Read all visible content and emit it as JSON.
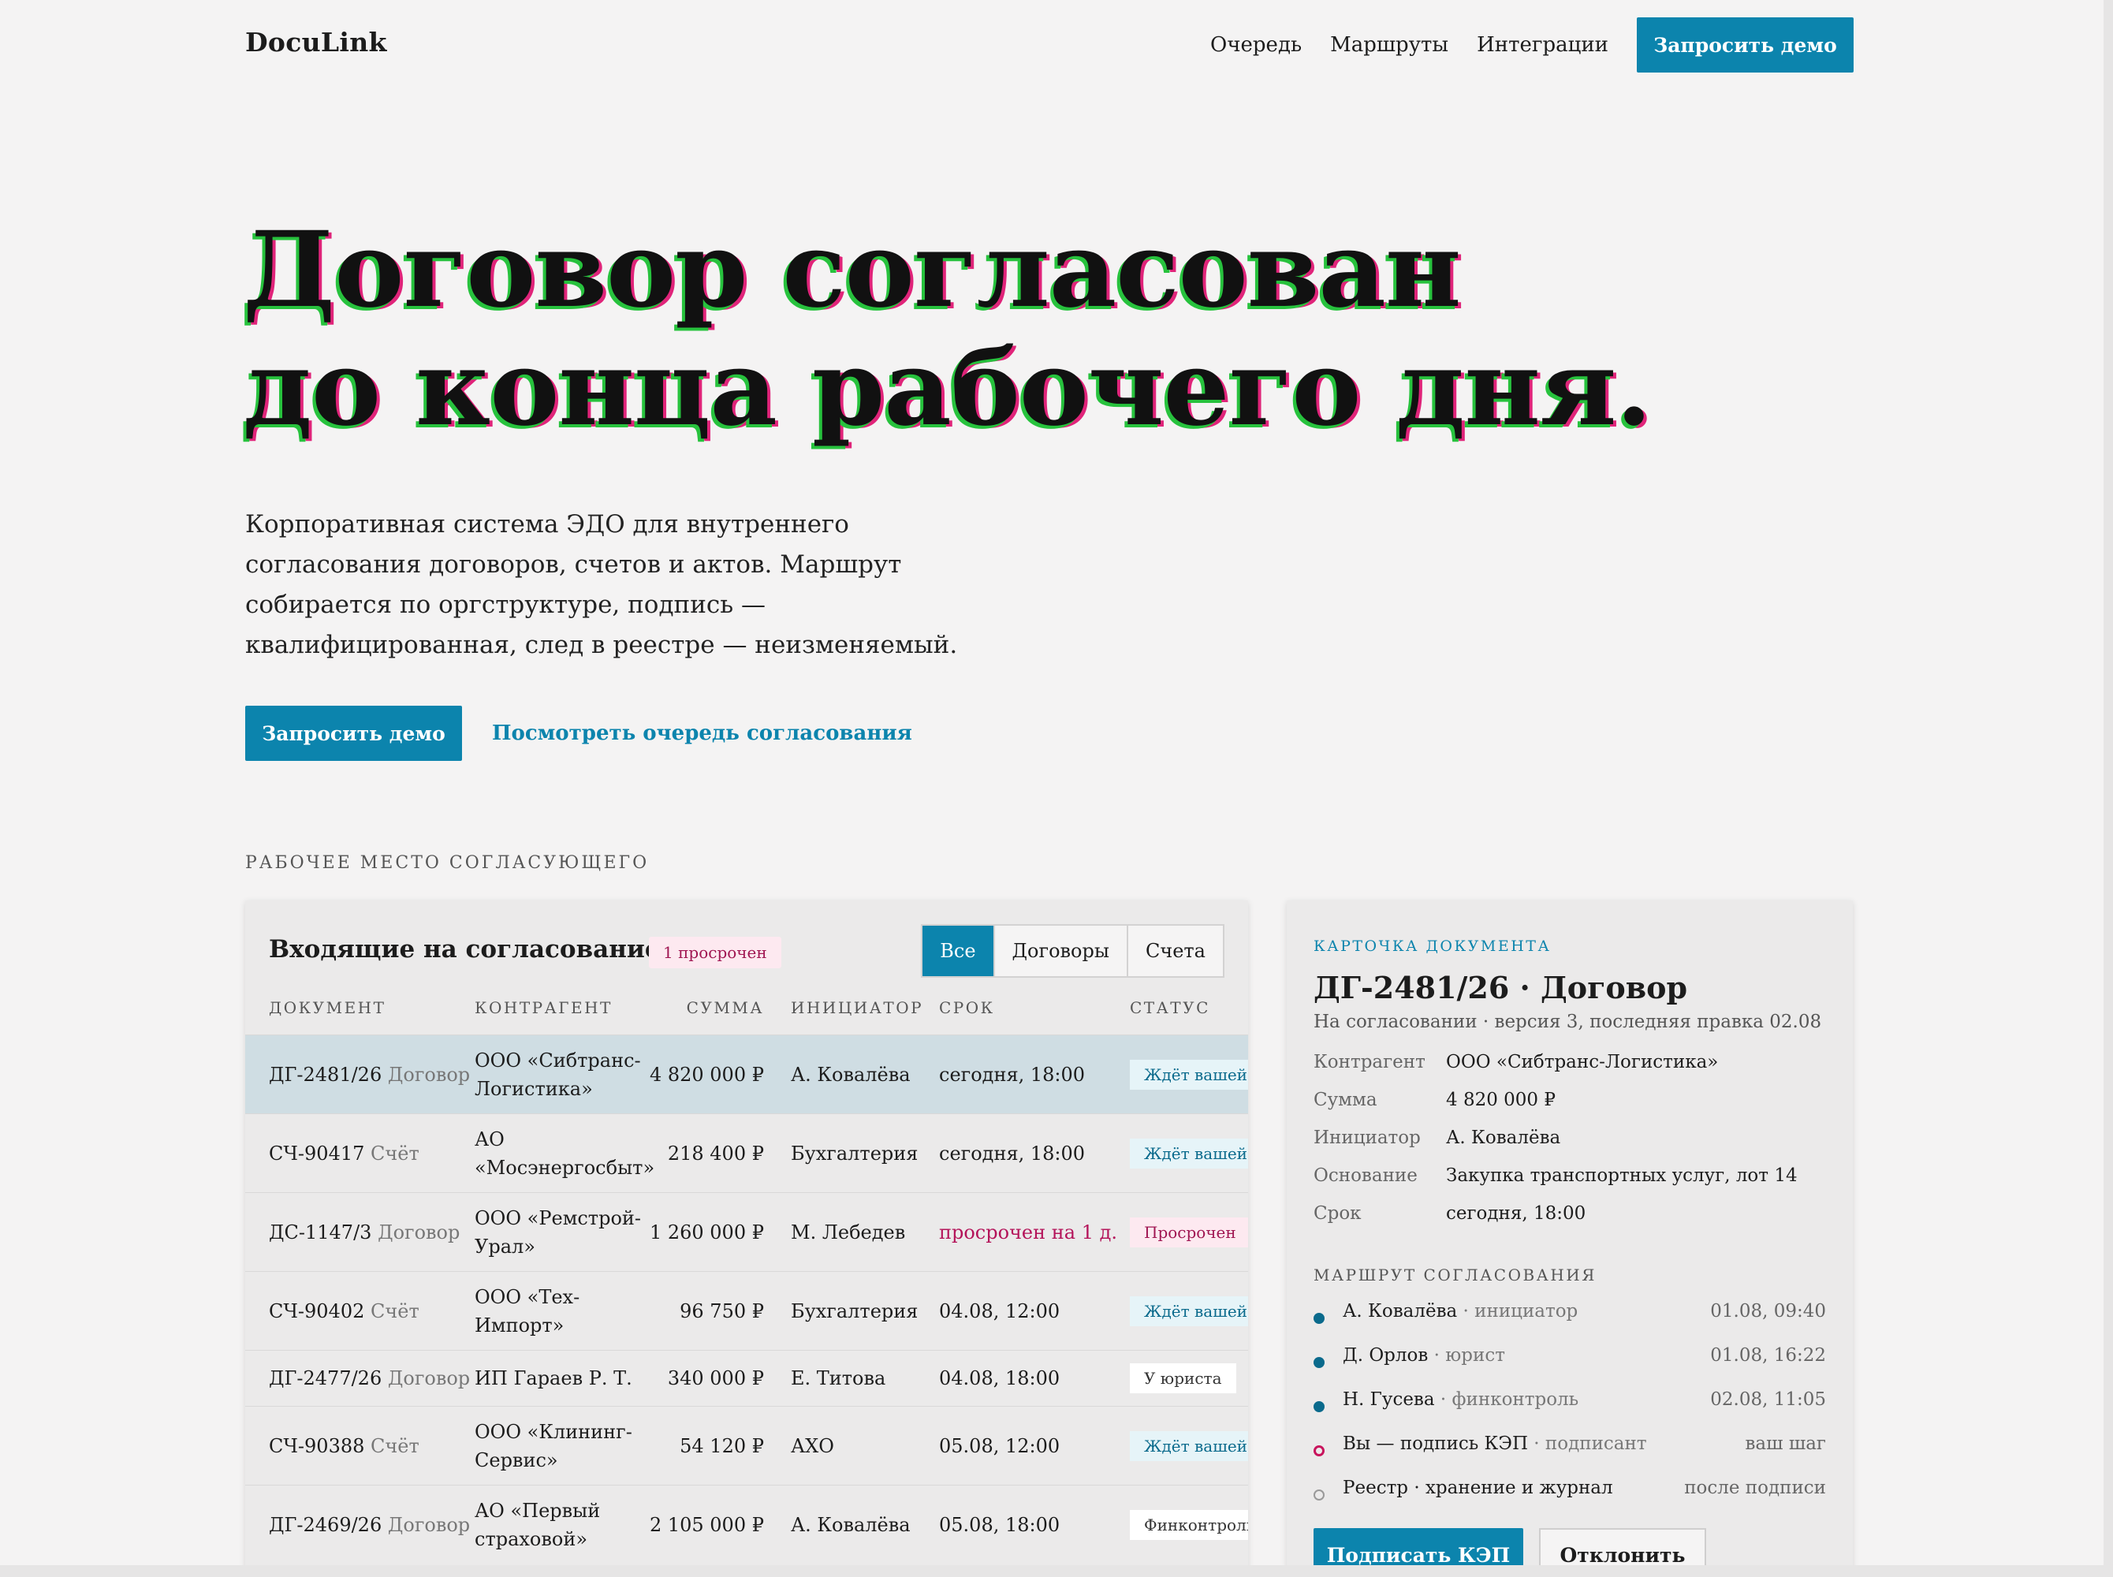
{
  "header": {
    "logo": "DocuLink",
    "nav": [
      "Очередь",
      "Маршруты",
      "Интеграции"
    ],
    "cta": "Запросить демо"
  },
  "hero": {
    "title_line1": "Договор согласован",
    "title_line2": "до конца рабочего дня.",
    "subtitle": "Корпоративная система ЭДО для внутреннего согласования договоров, счетов и актов. Маршрут собирается по оргструктуре, подпись — квалифицированная, след в реестре — неизменяемый.",
    "cta_primary": "Запросить демо",
    "cta_secondary": "Посмотреть очередь согласования"
  },
  "section_label": "РАБОЧЕЕ МЕСТО СОГЛАСУЮЩЕГО",
  "queue": {
    "title": "Входящие на согласование",
    "overdue_badge": "1 просрочен",
    "tabs": [
      "Все",
      "Договоры",
      "Счета"
    ],
    "active_tab": "Все",
    "columns": [
      "ДОКУМЕНТ",
      "КОНТРАГЕНТ",
      "СУММА",
      "ИНИЦИАТОР",
      "СРОК",
      "СТАТУС"
    ],
    "rows": [
      {
        "id": "ДГ-2481/26",
        "type": "Договор",
        "counterparty": "ООО «Сибтранс-Логистика»",
        "sum": "4 820 000 ₽",
        "initiator": "А. Ковалёва",
        "due": "сегодня, 18:00",
        "status": "Ждёт вашей",
        "status_kind": "wait",
        "selected": true
      },
      {
        "id": "СЧ-90417",
        "type": "Счёт",
        "counterparty": "АО «Мосэнергосбыт»",
        "sum": "218 400 ₽",
        "initiator": "Бухгалтерия",
        "due": "сегодня, 18:00",
        "status": "Ждёт вашей",
        "status_kind": "wait"
      },
      {
        "id": "ДС-1147/3",
        "type": "Договор",
        "counterparty": "ООО «Ремстрой-Урал»",
        "sum": "1 260 000 ₽",
        "initiator": "М. Лебедев",
        "due": "просрочен на 1 д.",
        "status": "Просрочен",
        "status_kind": "late"
      },
      {
        "id": "СЧ-90402",
        "type": "Счёт",
        "counterparty": "ООО «Тех-Импорт»",
        "sum": "96 750 ₽",
        "initiator": "Бухгалтерия",
        "due": "04.08, 12:00",
        "status": "Ждёт вашей",
        "status_kind": "wait"
      },
      {
        "id": "ДГ-2477/26",
        "type": "Договор",
        "counterparty": "ИП Гараев Р. Т.",
        "sum": "340 000 ₽",
        "initiator": "Е. Титова",
        "due": "04.08, 18:00",
        "status": "У юриста",
        "status_kind": "neutral"
      },
      {
        "id": "СЧ-90388",
        "type": "Счёт",
        "counterparty": "ООО «Клининг-Сервис»",
        "sum": "54 120 ₽",
        "initiator": "АХО",
        "due": "05.08, 12:00",
        "status": "Ждёт вашей",
        "status_kind": "wait"
      },
      {
        "id": "ДГ-2469/26",
        "type": "Договор",
        "counterparty": "АО «Первый страховой»",
        "sum": "2 105 000 ₽",
        "initiator": "А. Ковалёва",
        "due": "05.08, 18:00",
        "status": "Финконтроль",
        "status_kind": "neutral"
      }
    ]
  },
  "card": {
    "eyebrow": "КАРТОЧКА ДОКУМЕНТА",
    "title": "ДГ-2481/26 · Договор",
    "meta": "На согласовании · версия 3, последняя правка 02.08",
    "fields": [
      {
        "key": "Контрагент",
        "value": "ООО «Сибтранс-Логистика»"
      },
      {
        "key": "Сумма",
        "value": "4 820 000 ₽"
      },
      {
        "key": "Инициатор",
        "value": "А. Ковалёва"
      },
      {
        "key": "Основание",
        "value": "Закупка транспортных услуг, лот 14"
      },
      {
        "key": "Срок",
        "value": "сегодня, 18:00"
      }
    ],
    "route_label": "МАРШРУТ СОГЛАСОВАНИЯ",
    "route": [
      {
        "name": "А. Ковалёва",
        "role": " · инициатор",
        "when": "01.08, 09:40",
        "state": "done"
      },
      {
        "name": "Д. Орлов",
        "role": " · юрист",
        "when": "01.08, 16:22",
        "state": "done"
      },
      {
        "name": "Н. Гусева",
        "role": " · финконтроль",
        "when": "02.08, 11:05",
        "state": "done"
      },
      {
        "name": "Вы — подпись КЭП",
        "role": " · подписант",
        "when": "ваш шаг",
        "state": "current"
      },
      {
        "name": "Реестр · хранение и журнал",
        "role": "",
        "when": "после подписи",
        "state": "pending"
      }
    ],
    "sign_button": "Подписать КЭП",
    "reject_button": "Отклонить"
  },
  "colors": {
    "accent": "#0c84ad",
    "danger": "#b4145a",
    "selected_row": "#cfdde3"
  }
}
